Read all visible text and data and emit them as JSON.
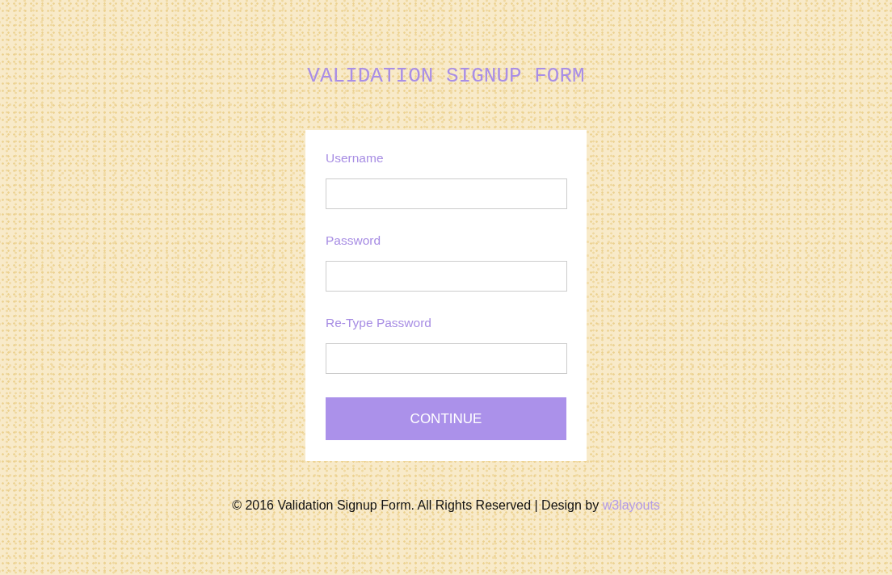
{
  "title": "VALIDATION SIGNUP FORM",
  "form": {
    "fields": [
      {
        "label": "Username"
      },
      {
        "label": "Password"
      },
      {
        "label": "Re-Type Password"
      }
    ],
    "submit_button": "CONTINUE"
  },
  "footer": {
    "text": "© 2016 Validation Signup Form. All Rights Reserved | Design by",
    "link": "w3layouts"
  }
}
